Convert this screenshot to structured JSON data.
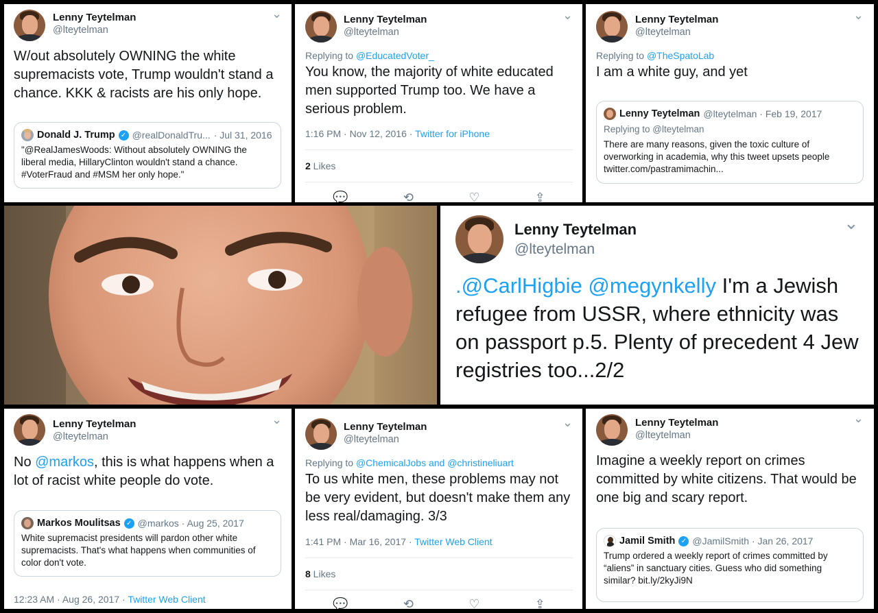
{
  "tweets": {
    "t1": {
      "name": "Lenny Teytelman",
      "handle": "@lteytelman",
      "text": "W/out absolutely OWNING the white supremacists vote, Trump wouldn't stand a chance. KKK & racists are his only hope.",
      "quote": {
        "name": "Donald J. Trump",
        "handle": "@realDonaldTru...",
        "date": "· Jul 31, 2016",
        "text": "\"@RealJamesWoods: Without absolutely OWNING the liberal media, HillaryClinton wouldn't stand a chance. #VoterFraud and #MSM her only hope.\""
      }
    },
    "t2": {
      "name": "Lenny Teytelman",
      "handle": "@lteytelman",
      "replying_prefix": "Replying to ",
      "replying_to": "@EducatedVoter_",
      "text": "You know, the majority of white educated men supported Trump too. We have a serious problem.",
      "time": "1:16 PM · Nov 12, 2016 · ",
      "client": "Twitter for iPhone",
      "likes_count": "2",
      "likes_label": " Likes"
    },
    "t3": {
      "name": "Lenny Teytelman",
      "handle": "@lteytelman",
      "replying_prefix": "Replying to ",
      "replying_to": "@TheSpatoLab",
      "text": "I am a white guy, and yet",
      "quote": {
        "name": "Lenny Teytelman",
        "handle": "@lteytelman · Feb 19, 2017",
        "replying": "Replying to @lteytelman",
        "text": "There are many reasons, given the toxic culture of overworking in academia, why this tweet upsets people twitter.com/pastramimachin..."
      }
    },
    "t4": {
      "name": "Lenny Teytelman",
      "handle": "@lteytelman",
      "mention1": ".@CarlHigbie",
      "mention2": " @megynkelly",
      "text": " I'm a Jewish refugee from USSR, where ethnicity was on passport p.5. Plenty of precedent 4 Jew registries too...2/2"
    },
    "t5": {
      "name": "Lenny Teytelman",
      "handle": "@lteytelman",
      "text_pre": "No ",
      "mention": "@markos",
      "text_post": ", this is what happens when a lot of racist white people do vote.",
      "quote": {
        "name": "Markos Moulitsas",
        "handle": "@markos · Aug 25, 2017",
        "text": "White supremacist presidents will pardon other white supremacists. That's what happens when communities of color don't vote."
      },
      "time": "12:23 AM · Aug 26, 2017 · ",
      "client": "Twitter Web Client"
    },
    "t6": {
      "name": "Lenny Teytelman",
      "handle": "@lteytelman",
      "replying_prefix": "Replying to ",
      "replying_to": "@ChemicalJobs and @christineliuart",
      "text": "To us white men, these problems may not be very evident, but doesn't make them any less real/damaging. 3/3",
      "time": "1:41 PM · Mar 16, 2017 · ",
      "client": "Twitter Web Client",
      "likes_count": "8",
      "likes_label": " Likes"
    },
    "t7": {
      "name": "Lenny Teytelman",
      "handle": "@lteytelman",
      "text": "Imagine a weekly report on crimes committed by white citizens. That would be one big and scary report.",
      "quote": {
        "name": "Jamil Smith",
        "handle": "@JamilSmith · Jan 26, 2017",
        "text": "Trump ordered a weekly report of crimes committed by “aliens” in sanctuary cities. Guess who did something similar? bit.ly/2kyJi9N"
      }
    }
  },
  "icons": {
    "chevron": "⌄",
    "verified": "✓",
    "reply": "💬",
    "retweet": "⟲",
    "like": "♡",
    "share": "⇪"
  },
  "colors": {
    "link": "#1da1f2",
    "muted": "#657786",
    "border": "#ccd6dd"
  }
}
